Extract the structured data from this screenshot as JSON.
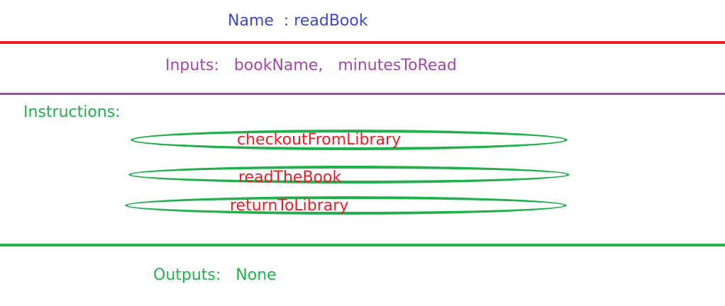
{
  "name_line": "Name  : readBook",
  "inputs_line": "Inputs:   bookName,   minutesToRead",
  "instructions_label": "Instructions:",
  "steps": [
    "checkoutFromLibrary",
    "readTheBook",
    "returnToLibrary"
  ],
  "outputs_line": "Outputs:   None",
  "colors": {
    "name": "#3b48cc",
    "inputs": "#a347a7",
    "instructions": "#22b04c",
    "step_text": "#ee1c24",
    "red_rule": "#ee1c24",
    "purple_rule": "#a347a7",
    "green_rule": "#22b04c"
  }
}
